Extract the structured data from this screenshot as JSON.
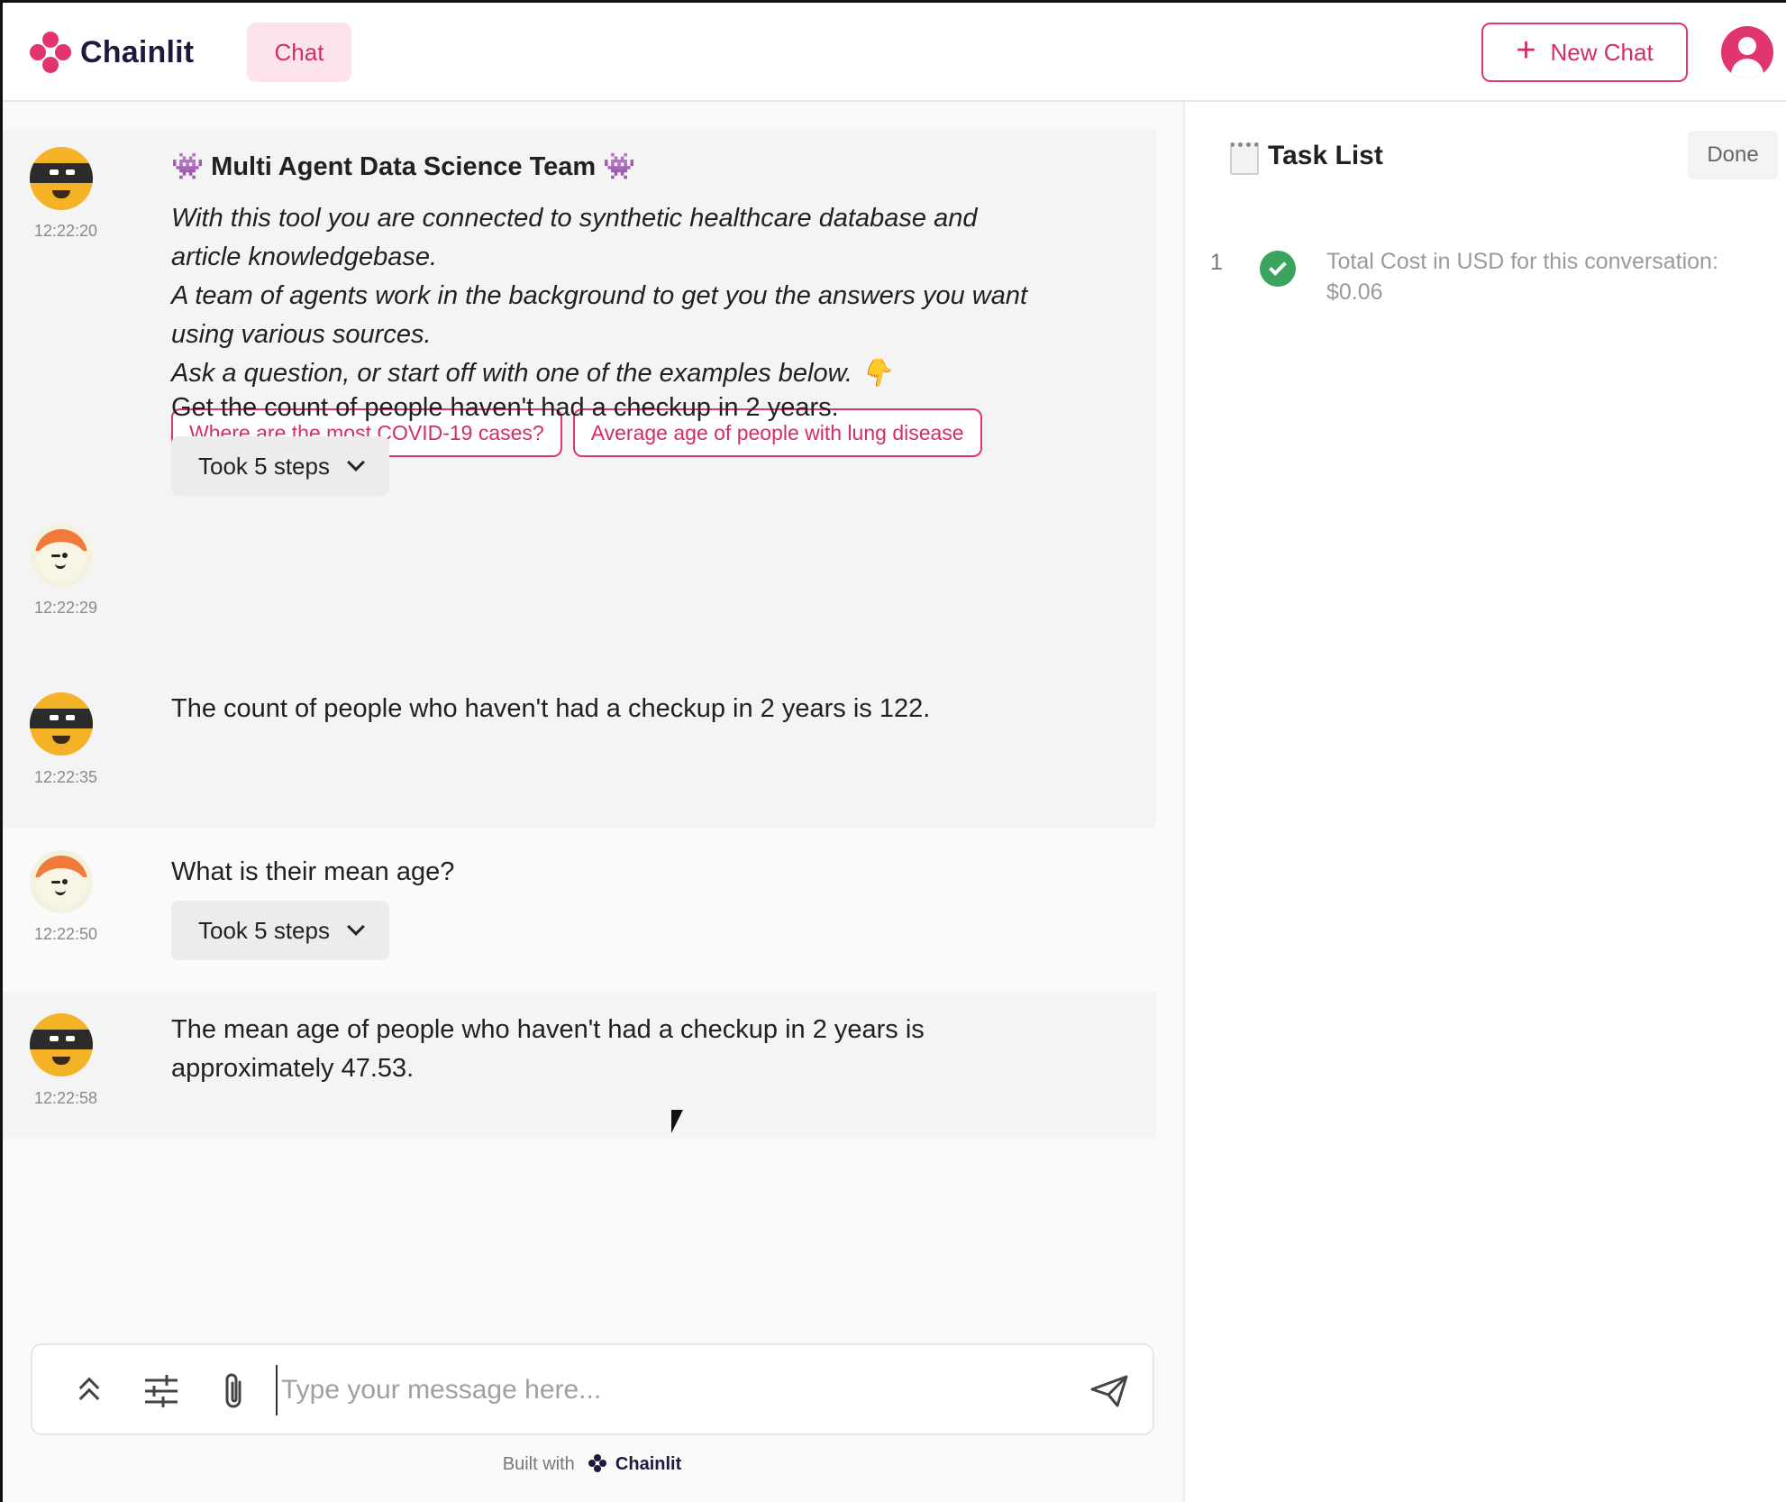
{
  "header": {
    "logo_text": "Chainlit",
    "tab_label": "Chat",
    "new_chat_label": "New Chat"
  },
  "messages": [
    {
      "author": "bot",
      "time": "12:22:20",
      "title": "👾 Multi Agent Data Science Team 👾",
      "lines": [
        "With this tool you are connected to synthetic healthcare database and",
        "article knowledgebase.",
        "A team of agents work in the background to get you the answers you want",
        "using various sources.",
        "Ask a question, or start off with one of the examples below. 👇"
      ],
      "actions": [
        "Where are the most COVID-19 cases?",
        "Average age of people with lung disease"
      ]
    },
    {
      "author": "user",
      "time": "12:22:29",
      "text": "Get the count of people haven't had a checkup in 2 years.",
      "steps": "Took 5 steps"
    },
    {
      "author": "bot",
      "time": "12:22:35",
      "text": "The count of people who haven't had a checkup in 2 years is 122."
    },
    {
      "author": "user",
      "time": "12:22:50",
      "text": "What is their mean age?",
      "steps": "Took 5 steps"
    },
    {
      "author": "bot",
      "time": "12:22:58",
      "lines": [
        "The mean age of people who haven't had a checkup in 2 years is",
        "approximately 47.53."
      ]
    }
  ],
  "composer": {
    "placeholder": "Type your message here...",
    "value": ""
  },
  "footer": {
    "built_with": "Built with",
    "brand": "Chainlit"
  },
  "task_panel": {
    "title": "Task List",
    "done_label": "Done",
    "tasks": [
      {
        "number": "1",
        "status": "done",
        "text_line1": "Total Cost in USD for this conversation:",
        "text_line2": "$0.06"
      }
    ]
  },
  "colors": {
    "accent": "#e2356d",
    "accent_bg": "#fde4ea",
    "success": "#3aa35c"
  }
}
